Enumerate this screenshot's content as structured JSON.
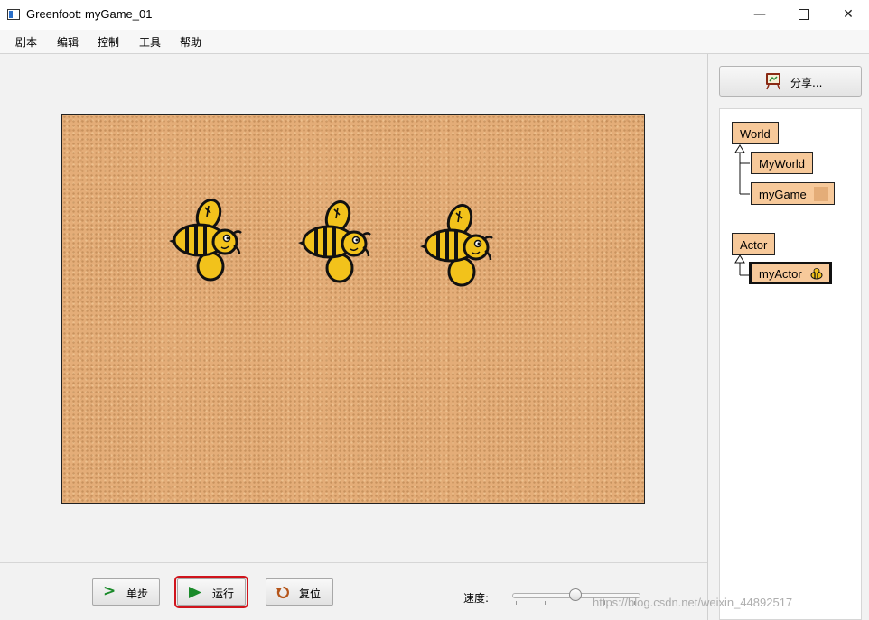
{
  "window": {
    "title": "Greenfoot: myGame_01",
    "controls": {
      "minimize": "—",
      "close": "✕"
    }
  },
  "menu": [
    "剧本",
    "编辑",
    "控制",
    "工具",
    "帮助"
  ],
  "share_button": {
    "label": "分享...",
    "icon": "easel-share-icon"
  },
  "class_tree": {
    "world_root": "World",
    "world_subclass": "MyWorld",
    "world_subclass2": "myGame",
    "actor_root": "Actor",
    "actor_subclass": "myActor"
  },
  "controls": {
    "step": {
      "label": "单步",
      "icon": "step-arrow-icon"
    },
    "run": {
      "label": "运行",
      "icon": "play-icon"
    },
    "reset": {
      "label": "复位",
      "icon": "reset-icon"
    },
    "speed_label": "速度:",
    "speed_level": 0.5
  },
  "world": {
    "actor_count": 3,
    "background": "cork-texture"
  },
  "colors": {
    "class_fill": "#f7c99a",
    "run_highlight": "#d0141c",
    "bee_yellow": "#f2c21b",
    "run_icon": "#1a8a2a"
  },
  "watermark": "https://blog.csdn.net/weixin_44892517"
}
